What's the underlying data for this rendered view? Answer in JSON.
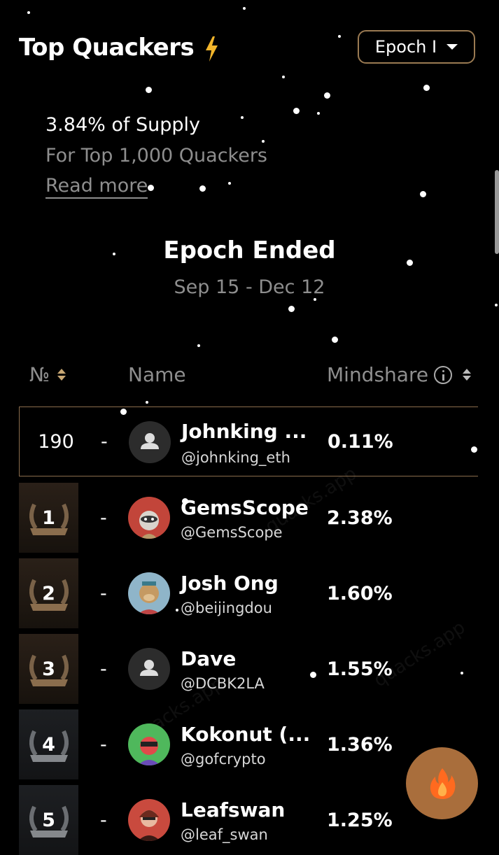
{
  "header": {
    "title": "Top Quackers",
    "epoch_select": "Epoch I"
  },
  "supply": {
    "percent": "3.84% of Supply",
    "subtitle": "For Top 1,000 Quackers",
    "read_more": "Read more"
  },
  "epoch": {
    "status": "Epoch Ended",
    "dates": "Sep 15 - Dec 12"
  },
  "table": {
    "col_rank": "№",
    "col_name": "Name",
    "col_mindshare": "Mindshare",
    "self_row": {
      "rank": "190",
      "sep": "-",
      "name": "Johnking ...",
      "handle": "@johnking_eth",
      "share": "0.11%"
    },
    "rows": [
      {
        "rank": "1",
        "sep": "-",
        "name": "GemsScope",
        "handle": "@GemsScope",
        "share": "2.38%"
      },
      {
        "rank": "2",
        "sep": "-",
        "name": "Josh Ong",
        "handle": "@beijingdou",
        "share": "1.60%"
      },
      {
        "rank": "3",
        "sep": "-",
        "name": "Dave",
        "handle": "@DCBK2LA",
        "share": "1.55%"
      },
      {
        "rank": "4",
        "sep": "-",
        "name": "Kokonut (...",
        "handle": "@gofcrypto",
        "share": "1.36%"
      },
      {
        "rank": "5",
        "sep": "-",
        "name": "Leafswan",
        "handle": "@leaf_swan",
        "share": "1.25%"
      }
    ]
  },
  "watermark": "quacks.app",
  "colors": {
    "accent": "#9a7a52",
    "fab": "#a96e3c",
    "muted": "#8e8e8e"
  },
  "icons": {
    "title": "lightning-icon",
    "fab": "fire-icon",
    "default_avatar": "user-icon"
  }
}
